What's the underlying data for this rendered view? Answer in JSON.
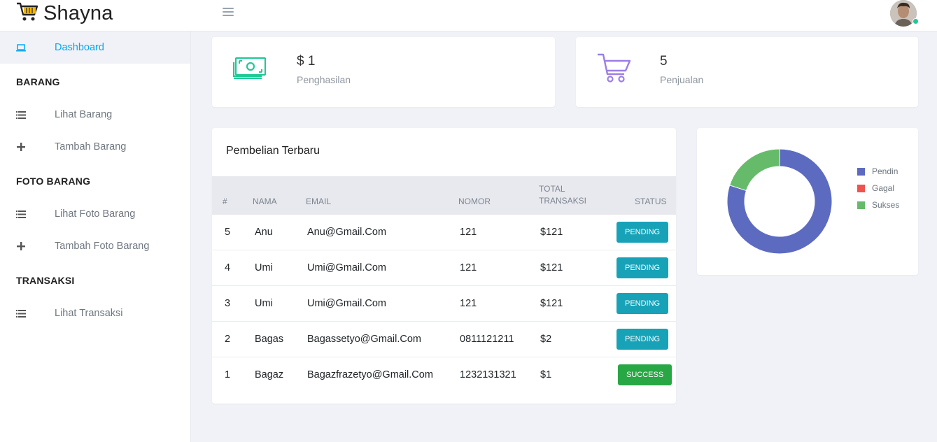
{
  "header": {
    "brand": "Shayna",
    "brand_accent": "#f5b800"
  },
  "sidebar": {
    "dashboard": "Dashboard",
    "sections": [
      {
        "title": "BARANG",
        "items": [
          "Lihat Barang",
          "Tambah Barang"
        ]
      },
      {
        "title": "FOTO BARANG",
        "items": [
          "Lihat Foto Barang",
          "Tambah Foto Barang"
        ]
      },
      {
        "title": "TRANSAKSI",
        "items": [
          "Lihat Transaksi"
        ]
      }
    ],
    "icons": {
      "dashboard": "laptop-icon",
      "list": "list-icon",
      "add": "plus-icon"
    },
    "accent": "#03a9f3"
  },
  "stats": [
    {
      "value": "$ 1",
      "label": "Penghasilan",
      "icon": "money-icon",
      "color": "#20c997"
    },
    {
      "value": "5",
      "label": "Penjualan",
      "icon": "cart-icon",
      "color": "#9c7ee6"
    }
  ],
  "table": {
    "title": "Pembelian Terbaru",
    "headers": [
      "#",
      "NAMA",
      "EMAIL",
      "NOMOR",
      "TOTAL TRANSAKSI",
      "STATUS"
    ],
    "rows": [
      {
        "no": "5",
        "nama": "Anu",
        "email": "Anu@Gmail.Com",
        "nomor": "121",
        "total": "$121",
        "status": "PENDING"
      },
      {
        "no": "4",
        "nama": "Umi",
        "email": "Umi@Gmail.Com",
        "nomor": "121",
        "total": "$121",
        "status": "PENDING"
      },
      {
        "no": "3",
        "nama": "Umi",
        "email": "Umi@Gmail.Com",
        "nomor": "121",
        "total": "$121",
        "status": "PENDING"
      },
      {
        "no": "2",
        "nama": "Bagas",
        "email": "Bagassetyo@Gmail.Com",
        "nomor": "0811121211",
        "total": "$2",
        "status": "PENDING"
      },
      {
        "no": "1",
        "nama": "Bagaz",
        "email": "Bagazfrazetyo@Gmail.Com",
        "nomor": "1232131321",
        "total": "$1",
        "status": "SUCCESS"
      }
    ],
    "status_colors": {
      "PENDING": "#17a2b8",
      "SUCCESS": "#28a745"
    }
  },
  "chart_data": {
    "type": "pie",
    "labels": [
      "Pendin",
      "Gagal",
      "Sukses"
    ],
    "values": [
      4,
      0,
      1
    ],
    "colors": [
      "#5c6bc0",
      "#ef5350",
      "#66bb6a"
    ],
    "legend": "right"
  }
}
